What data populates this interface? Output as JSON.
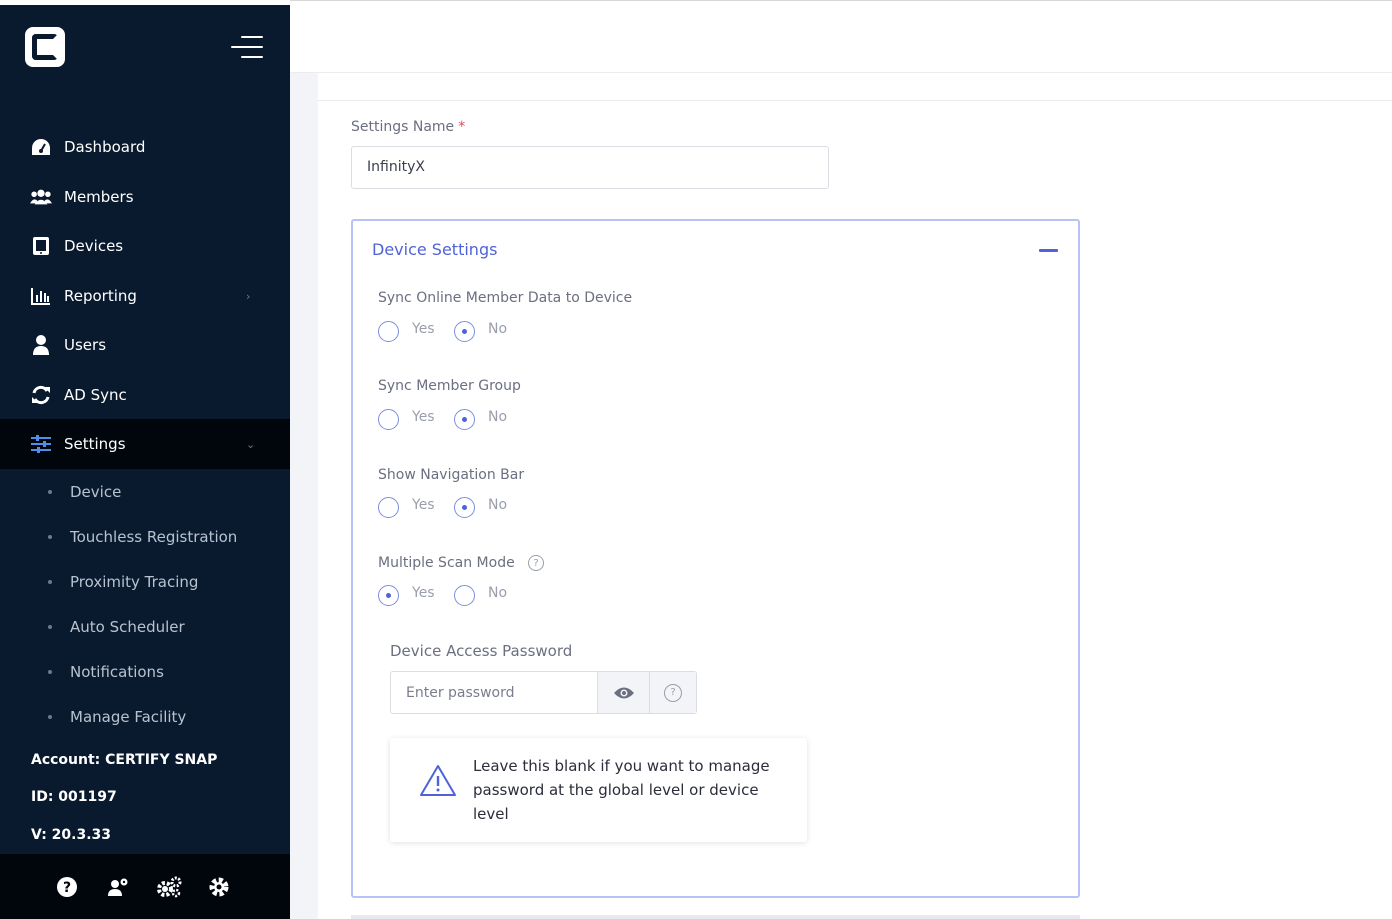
{
  "sidebar": {
    "logo_icon": "certify-logo-icon",
    "nav": [
      {
        "label": "Dashboard",
        "icon": "dashboard-icon"
      },
      {
        "label": "Members",
        "icon": "members-icon"
      },
      {
        "label": "Devices",
        "icon": "tablet-icon"
      },
      {
        "label": "Reporting",
        "icon": "chart-icon"
      },
      {
        "label": "Users",
        "icon": "user-icon"
      },
      {
        "label": "AD Sync",
        "icon": "sync-icon"
      },
      {
        "label": "Settings",
        "icon": "sliders-icon"
      }
    ],
    "sub": [
      {
        "label": "Device"
      },
      {
        "label": "Touchless Registration"
      },
      {
        "label": "Proximity Tracing"
      },
      {
        "label": "Auto Scheduler"
      },
      {
        "label": "Notifications"
      },
      {
        "label": "Manage Facility"
      }
    ],
    "account": "Account: CERTIFY SNAP",
    "id": "ID: 001197",
    "version": "V: 20.3.33",
    "footer_icons": [
      "help-icon",
      "user-settings-icon",
      "gears-icon",
      "gear-icon"
    ]
  },
  "form": {
    "settings_name_label": "Settings Name",
    "required_mark": "*",
    "settings_name_value": "InfinityX"
  },
  "device_settings": {
    "title": "Device Settings",
    "yes": "Yes",
    "no": "No",
    "q1": {
      "label": "Sync Online Member Data to Device",
      "selected": "No"
    },
    "q2": {
      "label": "Sync Member Group",
      "selected": "No"
    },
    "q3": {
      "label": "Show Navigation Bar",
      "selected": "No"
    },
    "q4": {
      "label": "Multiple Scan Mode",
      "selected": "Yes"
    },
    "password_label": "Device Access Password",
    "password_placeholder": "Enter password",
    "help_glyph": "?",
    "notice": "Leave this blank if you want to manage password at the global level or device level"
  },
  "colors": {
    "sidebar_bg": "#0a1a2e",
    "accent": "#4f63d8",
    "required": "#e84a4a"
  }
}
